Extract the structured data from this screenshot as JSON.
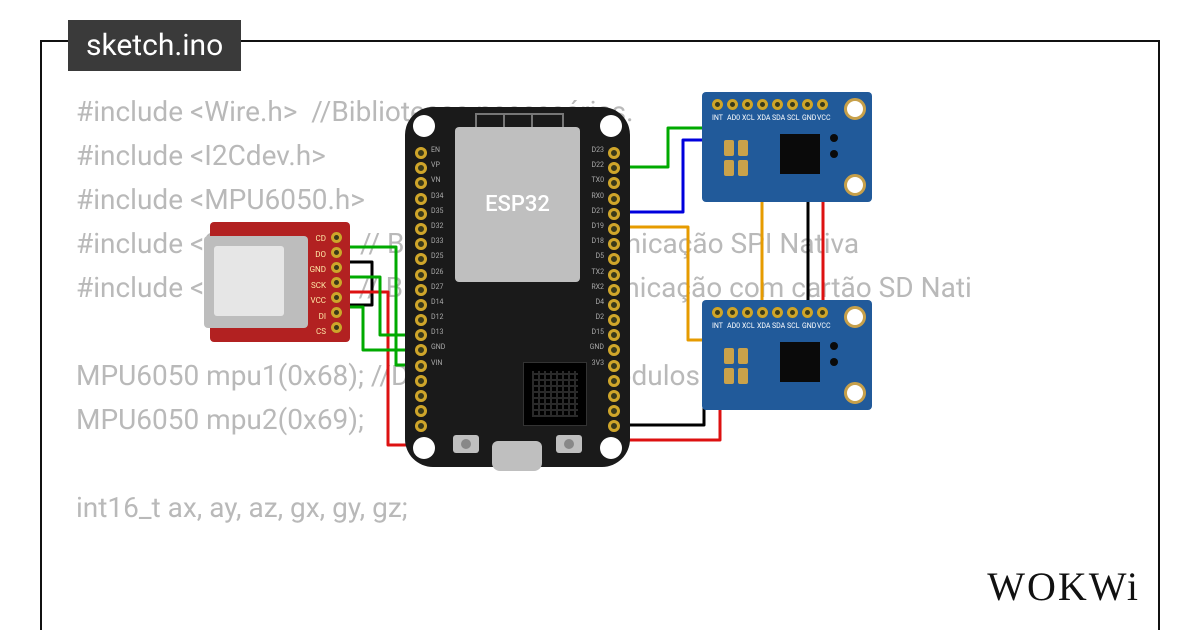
{
  "tab_title": "sketch.ino",
  "brand": "WOKWi",
  "esp32_label": "ESP32",
  "code_lines": [
    "#include <Wire.h>  //Bibliotecas necessárias.",
    "#include <I2Cdev.h>",
    "#include <MPU6050.h>",
    "#include <SPI.h>           // Biblioteca de comunicação SPI Nativa",
    "#include <SD.h>            // Biblioteca de comunicação com cartão SD Nati",
    "",
    "MPU6050 mpu1(0x68); //Declaração dos modulos.",
    "MPU6050 mpu2(0x69);",
    "",
    "int16_t ax, ay, az, gx, gy, gz;"
  ],
  "esp32_pins_left": [
    "EN",
    "VP",
    "VN",
    "D34",
    "D35",
    "D32",
    "D33",
    "D25",
    "D26",
    "D27",
    "D14",
    "D12",
    "D13",
    "GND",
    "VIN"
  ],
  "esp32_pins_right": [
    "D23",
    "D22",
    "TX0",
    "RX0",
    "D21",
    "D19",
    "D18",
    "D5",
    "TX2",
    "RX2",
    "D4",
    "D2",
    "D15",
    "GND",
    "3V3"
  ],
  "mpu_pins": [
    "INT",
    "AD0",
    "XCL",
    "XDA",
    "SDA",
    "SCL",
    "GND",
    "VCC"
  ],
  "sd_pins": [
    "CD",
    "DO",
    "GND",
    "SCK",
    "VCC",
    "DI",
    "CS"
  ],
  "components": {
    "esp32": "ESP32 DevKit",
    "mpu1": "MPU6050 (0x68)",
    "mpu2": "MPU6050 (0x69)",
    "sd": "MicroSD card module"
  },
  "wires": [
    {
      "from": "ESP32 GND",
      "to": "SD GND",
      "color": "#000"
    },
    {
      "from": "ESP32 3V3",
      "to": "SD VCC",
      "color": "#d11"
    },
    {
      "from": "ESP32 D12",
      "to": "SD DO",
      "color": "#0a0"
    },
    {
      "from": "ESP32 D13",
      "to": "SD DI",
      "color": "#0a0"
    },
    {
      "from": "ESP32 D14",
      "to": "SD SCK",
      "color": "#0a0"
    },
    {
      "from": "ESP32 D22",
      "to": "MPU1 SCL",
      "color": "#0a0"
    },
    {
      "from": "ESP32 D21",
      "to": "MPU1 SDA",
      "color": "#00d"
    },
    {
      "from": "ESP32 D22",
      "to": "MPU2 SCL",
      "color": "#d90"
    },
    {
      "from": "ESP32 D21",
      "to": "MPU2 SDA",
      "color": "#d90"
    },
    {
      "from": "ESP32 GND",
      "to": "MPU GND",
      "color": "#000"
    },
    {
      "from": "ESP32 3V3",
      "to": "MPU VCC",
      "color": "#d11"
    }
  ]
}
